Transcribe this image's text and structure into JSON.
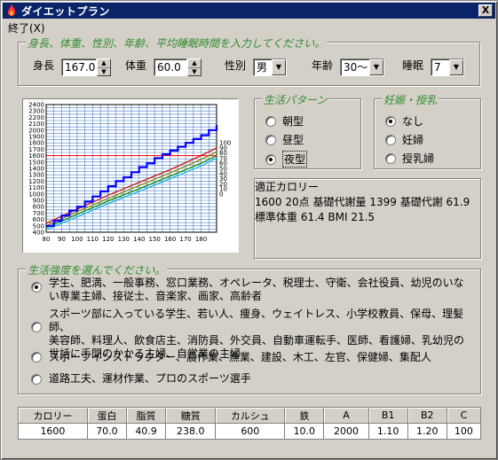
{
  "window": {
    "title": "ダイエットプラン",
    "close_glyph": "X"
  },
  "menu": {
    "exit": "終了(X)"
  },
  "inputs": {
    "legend": "身長、体重、性別、年齢、平均睡眠時間を入力してください。",
    "height_label": "身長",
    "height_value": "167.0",
    "weight_label": "体重",
    "weight_value": "60.0",
    "sex_label": "性別",
    "sex_value": "男",
    "age_label": "年齢",
    "age_value": "30～",
    "sleep_label": "睡眠",
    "sleep_value": "7"
  },
  "life_pattern": {
    "legend": "生活パターン",
    "options": [
      "朝型",
      "昼型",
      "夜型"
    ],
    "selected": 2
  },
  "pregnancy": {
    "legend": "妊娠・授乳",
    "options": [
      "なし",
      "妊婦",
      "授乳婦"
    ],
    "selected": 0
  },
  "stats": {
    "calorie_label": "適正カロリー",
    "calorie_value": "1600",
    "points": "20点",
    "bmr_amount_label": "基礎代謝量",
    "bmr_amount_value": "1399",
    "bmr_label": "基礎代謝",
    "bmr_value": "61.9",
    "std_weight_label": "標準体重",
    "std_weight_value": "61.4",
    "bmi_label": "BMI",
    "bmi_value": "21.5"
  },
  "activity": {
    "legend": "生活強度を選んでください。",
    "selected": 0,
    "options": [
      [
        "学生、肥満、一般事務、窓口業務、オペレータ、税理士、守衛、会社役員、幼児のいな",
        "い専業主婦、接従士、音楽家、画家、高齢者"
      ],
      [
        "スポーツ部に入っている学生、若い人、痩身、ウェイトレス、小学校教員、保母、理髪師、",
        "美容師、料理人、飲食店主、消防員、外交員、自動車運転手、医師、看護婦、乳幼児の",
        "世話に手間のかかる主婦、自営業の主婦"
      ],
      [
        "スポーツインストラクター、農作業、漁業、建設、木工、左官、保健婦、集配人"
      ],
      [
        "道路工夫、運材作業、プロのスポーツ選手"
      ]
    ]
  },
  "nutrients": {
    "headers": [
      "カロリー",
      "蛋白",
      "脂質",
      "糖質",
      "カルシュ",
      "鉄",
      "A",
      "B1",
      "B2",
      "C"
    ],
    "values": [
      "1600",
      "70.0",
      "40.9",
      "238.0",
      "600",
      "10.0",
      "2000",
      "1.10",
      "1.20",
      "100"
    ]
  },
  "chart_data": {
    "type": "line",
    "x_ticks": [
      "80",
      "90",
      "100",
      "110",
      "120",
      "130",
      "140",
      "150",
      "160",
      "170",
      "180"
    ],
    "y_left_ticks": [
      "2400",
      "2300",
      "2200",
      "2100",
      "2000",
      "1900",
      "1800",
      "1700",
      "1600",
      "1500",
      "1400",
      "1300",
      "1200",
      "1100",
      "1000",
      "900",
      "800",
      "700",
      "600",
      "500",
      "400"
    ],
    "y_right_ticks": [
      "100",
      "90",
      "80",
      "70",
      "60",
      "50",
      "40",
      "30",
      "20",
      "10",
      "0"
    ],
    "xlim": [
      80,
      190
    ],
    "ylim": [
      400,
      2400
    ],
    "ylim_right": [
      0,
      100
    ],
    "reference_line": {
      "y": 1600,
      "color": "#ff0000"
    },
    "step_series": {
      "color": "#0000ff",
      "x": [
        80,
        85,
        90,
        95,
        100,
        105,
        110,
        115,
        120,
        125,
        130,
        135,
        140,
        145,
        150,
        155,
        160,
        165,
        170,
        175,
        180,
        185,
        190
      ],
      "y": [
        500,
        580,
        660,
        740,
        800,
        880,
        960,
        1040,
        1120,
        1200,
        1260,
        1340,
        1420,
        1480,
        1560,
        1620,
        1680,
        1740,
        1800,
        1860,
        1920,
        2000,
        2080
      ]
    },
    "series": [
      {
        "color": "#cc0000",
        "x": [
          80,
          100,
          120,
          140,
          160,
          180,
          190
        ],
        "y": [
          540,
          760,
          980,
          1180,
          1380,
          1600,
          1720
        ]
      },
      {
        "color": "#808000",
        "x": [
          80,
          100,
          120,
          140,
          160,
          180,
          190
        ],
        "y": [
          500,
          720,
          930,
          1130,
          1330,
          1540,
          1660
        ]
      },
      {
        "color": "#008000",
        "x": [
          80,
          100,
          120,
          140,
          160,
          180,
          190
        ],
        "y": [
          470,
          680,
          890,
          1080,
          1280,
          1480,
          1600
        ]
      },
      {
        "color": "#00b0f0",
        "x": [
          80,
          100,
          120,
          140,
          160,
          180,
          190
        ],
        "y": [
          440,
          640,
          850,
          1040,
          1240,
          1440,
          1560
        ]
      }
    ],
    "colors": {
      "grid": "#4a7ec8",
      "axis": "#000000"
    }
  }
}
